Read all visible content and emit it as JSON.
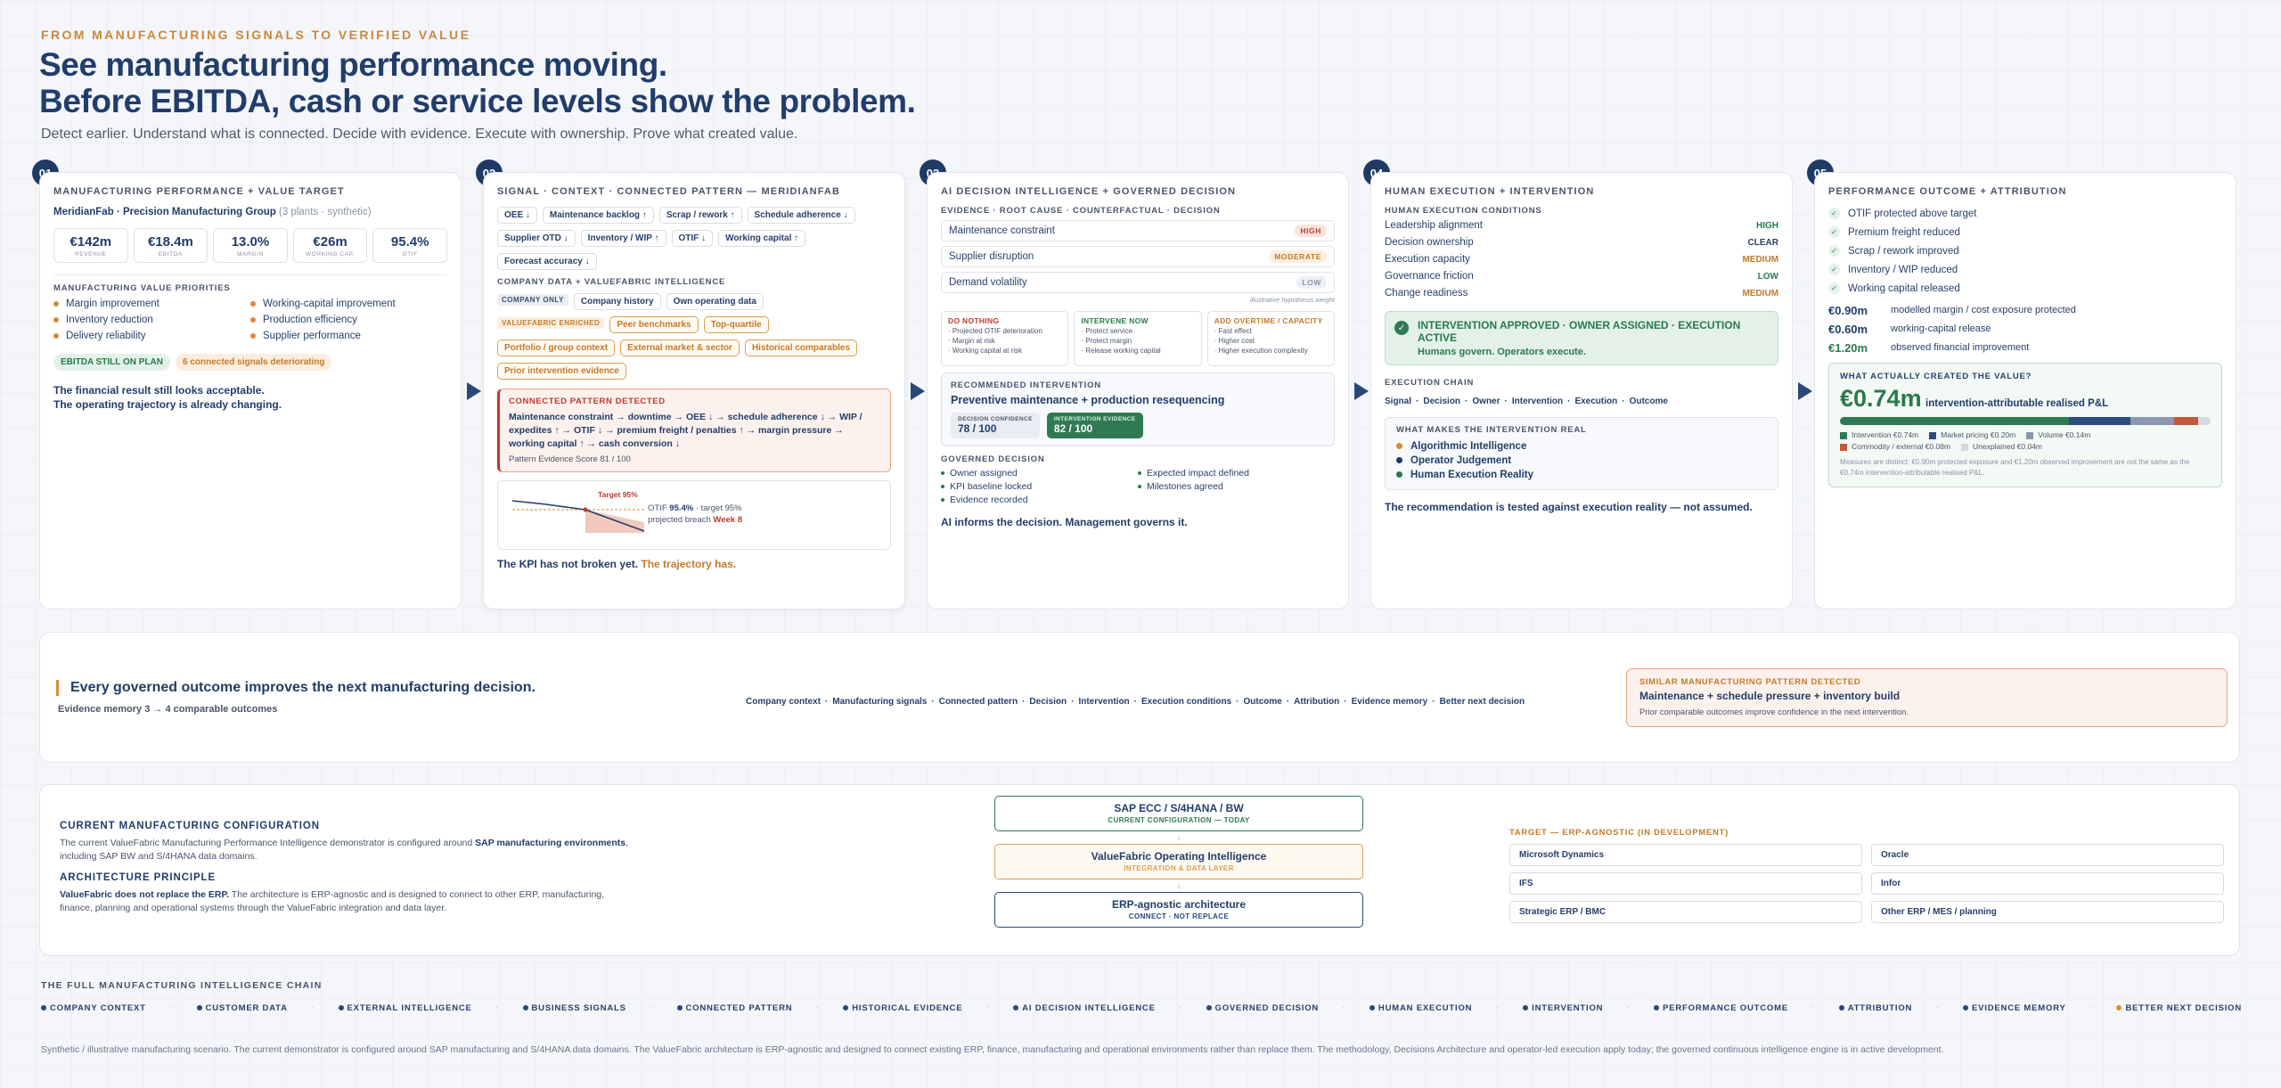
{
  "header": {
    "eyebrow": "FROM MANUFACTURING SIGNALS TO VERIFIED VALUE",
    "title_line1": "See manufacturing performance moving.",
    "title_line2": "Before EBITDA, cash or service levels show the problem.",
    "subtitle": "Detect earlier. Understand what is connected. Decide with evidence. Execute with ownership. Prove what created value."
  },
  "s1": {
    "num": "01",
    "title": "MANUFACTURING PERFORMANCE + VALUE TARGET",
    "company": "MeridianFab · Precision Manufacturing Group",
    "company_note": "(3 plants · synthetic)",
    "kpis": [
      {
        "v": "€142m",
        "l": "REVENUE"
      },
      {
        "v": "€18.4m",
        "l": "EBITDA"
      },
      {
        "v": "13.0%",
        "l": "MARGIN"
      },
      {
        "v": "€26m",
        "l": "WORKING CAP."
      },
      {
        "v": "95.4%",
        "l": "OTIF"
      }
    ],
    "priorities_title": "MANUFACTURING VALUE PRIORITIES",
    "priorities": [
      "Margin improvement",
      "Working-capital improvement",
      "Inventory reduction",
      "Production efficiency",
      "Delivery reliability",
      "Supplier performance"
    ],
    "badge_ok": "EBITDA STILL ON PLAN",
    "badge_warn": "6 connected signals deteriorating",
    "foot1": "The financial result still looks acceptable.",
    "foot2": "The operating trajectory is already changing."
  },
  "s2": {
    "num": "02",
    "title": "SIGNAL · CONTEXT · CONNECTED PATTERN — MERIDIANFAB",
    "signals": [
      "OEE ↓",
      "Maintenance backlog ↑",
      "Scrap / rework ↑",
      "Schedule adherence ↓",
      "Supplier OTD ↓",
      "Inventory / WIP ↑",
      "OTIF ↓",
      "Working capital ↑",
      "Forecast accuracy ↓"
    ],
    "company_title": "COMPANY DATA + VALUEFABRIC INTELLIGENCE",
    "co_tag": "COMPANY ONLY",
    "co_items": [
      "Company history",
      "Own operating data"
    ],
    "vf_tag": "VALUEFABRIC ENRICHED",
    "vf_items": [
      "Peer benchmarks",
      "Top-quartile",
      "Portfolio / group context",
      "External market & sector",
      "Historical comparables",
      "Prior intervention evidence"
    ],
    "pattern_title": "CONNECTED PATTERN DETECTED",
    "pattern_text": "Maintenance constraint → downtime → OEE ↓ → schedule adherence ↓ → WIP / expedites ↑ → OTIF ↓ → premium freight / penalties ↑ → margin pressure → working capital ↑ → cash conversion ↓",
    "pattern_score": "Pattern Evidence Score 81 / 100",
    "chart_target": "Target 95%",
    "otif_label": "OTIF",
    "otif_value": "95.4%",
    "otif_target": "· target 95%",
    "breach_label": "projected breach",
    "breach_week": "Week 8",
    "foot_a": "The KPI has not broken yet.",
    "foot_b": "The trajectory has."
  },
  "s3": {
    "num": "03",
    "title": "AI DECISION INTELLIGENCE + GOVERNED DECISION",
    "evidence_title": "EVIDENCE · ROOT CAUSE · COUNTERFACTUAL · DECISION",
    "evidence": [
      {
        "label": "Maintenance constraint",
        "level": "HIGH"
      },
      {
        "label": "Supplier disruption",
        "level": "MODERATE"
      },
      {
        "label": "Demand volatility",
        "level": "LOW"
      }
    ],
    "weight_note": "illustrative hypothesis weight",
    "options": [
      {
        "t": "DO NOTHING",
        "items": [
          "Projected OTIF deterioration",
          "Margin at risk",
          "Working capital at risk"
        ],
        "c": "#c0392b"
      },
      {
        "t": "INTERVENE NOW",
        "items": [
          "Protect service",
          "Protect margin",
          "Release working capital"
        ],
        "c": "#2a7a4c"
      },
      {
        "t": "ADD OVERTIME / CAPACITY",
        "items": [
          "Fast effect",
          "Higher cost",
          "Higher execution complexity"
        ],
        "c": "#c37a2a"
      }
    ],
    "rec_title": "RECOMMENDED INTERVENTION",
    "rec_text": "Preventive maintenance + production resequencing",
    "conf_label": "DECISION CONFIDENCE",
    "conf_val": "78 / 100",
    "ev_label": "INTERVENTION EVIDENCE",
    "ev_val": "82 / 100",
    "gov_title": "GOVERNED DECISION",
    "gov": [
      "Owner assigned",
      "Expected impact defined",
      "KPI baseline locked",
      "Milestones agreed",
      "Evidence recorded"
    ],
    "foot": "AI informs the decision. Management governs it."
  },
  "s4": {
    "num": "04",
    "title": "HUMAN EXECUTION + INTERVENTION",
    "cond_title": "HUMAN EXECUTION CONDITIONS",
    "conds": [
      {
        "l": "Leadership alignment",
        "v": "HIGH",
        "c": "#2a7a4c"
      },
      {
        "l": "Decision ownership",
        "v": "CLEAR",
        "c": "#28406a"
      },
      {
        "l": "Execution capacity",
        "v": "MEDIUM",
        "c": "#c37a2a"
      },
      {
        "l": "Governance friction",
        "v": "LOW",
        "c": "#2a7a4c"
      },
      {
        "l": "Change readiness",
        "v": "MEDIUM",
        "c": "#c37a2a"
      }
    ],
    "approved": "INTERVENTION APPROVED · OWNER ASSIGNED · EXECUTION ACTIVE",
    "approved_sub": "Humans govern. Operators execute.",
    "chain_title": "EXECUTION CHAIN",
    "chain": [
      "Signal",
      "Decision",
      "Owner",
      "Intervention",
      "Execution",
      "Outcome"
    ],
    "real_title": "WHAT MAKES THE INTERVENTION REAL",
    "real": [
      {
        "t": "Algorithmic Intelligence",
        "c": "#d58b3a"
      },
      {
        "t": "Operator Judgement",
        "c": "#1f3a64"
      },
      {
        "t": "Human Execution Reality",
        "c": "#2a7a4c"
      }
    ],
    "foot": "The recommendation is tested against execution reality — not assumed."
  },
  "s5": {
    "num": "05",
    "title": "PERFORMANCE OUTCOME + ATTRIBUTION",
    "checks": [
      "OTIF protected above target",
      "Premium freight reduced",
      "Scrap / rework improved",
      "Inventory / WIP reduced",
      "Working capital released"
    ],
    "values": [
      {
        "v": "€0.90m",
        "l": "modelled margin / cost exposure protected",
        "c": "#213d6b"
      },
      {
        "v": "€0.60m",
        "l": "working-capital release",
        "c": "#213d6b"
      },
      {
        "v": "€1.20m",
        "l": "observed financial improvement",
        "c": "#2a7a4c"
      }
    ],
    "box_title": "WHAT ACTUALLY CREATED THE VALUE?",
    "big": "€0.74m",
    "big_label": "intervention-attributable realised P&L",
    "legend": [
      {
        "t": "Intervention €0.74m",
        "c": "#2f7a52",
        "f": 0.617
      },
      {
        "t": "Market pricing €0.20m",
        "c": "#2f4c80",
        "f": 0.167
      },
      {
        "t": "Volume €0.14m",
        "c": "#8a97ad",
        "f": 0.117
      },
      {
        "t": "Commodity / external €0.08m",
        "c": "#c2593a",
        "f": 0.066
      },
      {
        "t": "Unexplained €0.04m",
        "c": "#d5dae2",
        "f": 0.033
      }
    ],
    "note": "Measures are distinct: €0.90m protected exposure and €1.20m observed improvement are not the same as the €0.74m intervention-attributable realised P&L."
  },
  "memory": {
    "title": "Every governed outcome improves the next manufacturing decision.",
    "evidence_line": "Evidence memory  3 → 4 comparable outcomes",
    "chain": [
      "Company context",
      "Manufacturing signals",
      "Connected pattern",
      "Decision",
      "Intervention",
      "Execution conditions",
      "Outcome",
      "Attribution",
      "Evidence memory",
      "Better next decision"
    ],
    "sim_title": "SIMILAR MANUFACTURING PATTERN DETECTED",
    "sim_text": "Maintenance + schedule pressure + inventory build",
    "sim_sub": "Prior comparable outcomes improve confidence in the next intervention."
  },
  "config": {
    "cur_title": "CURRENT MANUFACTURING CONFIGURATION",
    "cur_text_a": "The current ValueFabric Manufacturing Performance Intelligence demonstrator is configured around ",
    "cur_text_b": "SAP manufacturing environments",
    "cur_text_c": ", including SAP BW and S/4HANA data domains.",
    "arch_title": "ARCHITECTURE PRINCIPLE",
    "arch_b": "ValueFabric does not replace the ERP.",
    "arch_text": " The architecture is ERP-agnostic and is designed to connect to other ERP, manufacturing, finance, planning and operational systems through the ValueFabric integration and data layer.",
    "stack": [
      {
        "t": "SAP ECC / S/4HANA / BW",
        "s": "CURRENT CONFIGURATION — TODAY",
        "c": "#2f7a52",
        "bg": "#fff"
      },
      {
        "t": "ValueFabric Operating Intelligence",
        "s": "INTEGRATION & DATA LAYER",
        "c": "#d9a052",
        "bg": "#fffaf1"
      },
      {
        "t": "ERP-agnostic architecture",
        "s": "CONNECT · NOT REPLACE",
        "c": "#2a4777",
        "bg": "#fff"
      }
    ],
    "target_title": "TARGET — ERP-AGNOSTIC (IN DEVELOPMENT)",
    "erps": [
      "Microsoft Dynamics",
      "Oracle",
      "IFS",
      "Infor",
      "Strategic ERP / BMC",
      "Other ERP / MES / planning"
    ]
  },
  "footer": {
    "chain_title": "THE FULL MANUFACTURING INTELLIGENCE CHAIN",
    "chain": [
      "COMPANY CONTEXT",
      "CUSTOMER DATA",
      "EXTERNAL INTELLIGENCE",
      "BUSINESS SIGNALS",
      "CONNECTED PATTERN",
      "HISTORICAL EVIDENCE",
      "AI DECISION INTELLIGENCE",
      "GOVERNED DECISION",
      "HUMAN EXECUTION",
      "INTERVENTION",
      "PERFORMANCE OUTCOME",
      "ATTRIBUTION",
      "EVIDENCE MEMORY",
      "BETTER NEXT DECISION"
    ],
    "disclaimer": "Synthetic / illustrative manufacturing scenario. The current demonstrator is configured around SAP manufacturing and S/4HANA data domains. The ValueFabric architecture is ERP-agnostic and designed to connect existing ERP, finance, manufacturing and operational environments rather than replace them. The methodology, Decisions Architecture and operator-led execution apply today; the governed continuous intelligence engine is in active development."
  },
  "colors": {
    "navy": "#1f3a64",
    "orange": "#c8893a",
    "green": "#2a7a4c",
    "red": "#c0392b"
  }
}
